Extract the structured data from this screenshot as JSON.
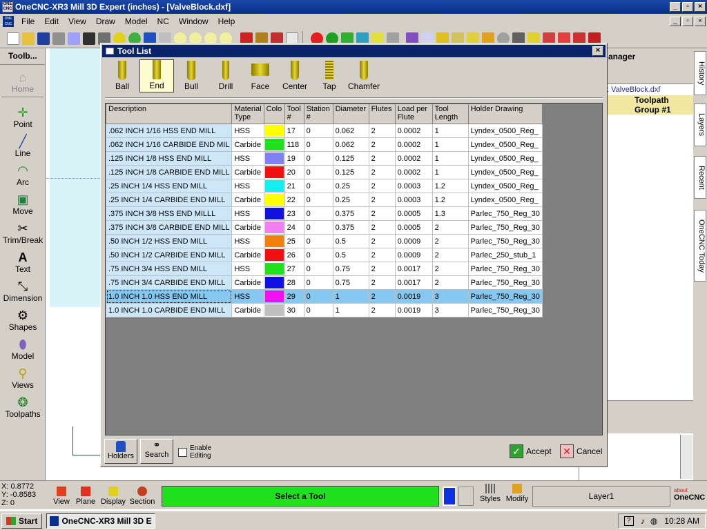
{
  "app": {
    "title": "OneCNC-XR3 Mill 3D Expert (inches) - [ValveBlock.dxf]",
    "window_controls": [
      "_",
      "▫",
      "×"
    ]
  },
  "menu": [
    "File",
    "Edit",
    "View",
    "Draw",
    "Model",
    "NC",
    "Window",
    "Help"
  ],
  "left_panel": {
    "header": "Toolb...",
    "items": [
      {
        "label": "Home",
        "icon": "home-icon"
      },
      {
        "label": "Point",
        "icon": "point-icon"
      },
      {
        "label": "Line",
        "icon": "line-icon"
      },
      {
        "label": "Arc",
        "icon": "arc-icon"
      },
      {
        "label": "Move",
        "icon": "move-icon"
      },
      {
        "label": "Trim/Break",
        "icon": "scissors-icon"
      },
      {
        "label": "Text",
        "icon": "text-icon"
      },
      {
        "label": "Dimension",
        "icon": "dimension-icon"
      },
      {
        "label": "Shapes",
        "icon": "shapes-icon"
      },
      {
        "label": "Model",
        "icon": "model-icon"
      },
      {
        "label": "Views",
        "icon": "views-icon"
      },
      {
        "label": "Toolpaths",
        "icon": "toolpaths-icon"
      }
    ]
  },
  "right_panel": {
    "header": "anager",
    "file": ": ValveBlock.dxf",
    "group": "Toolpath Group #1"
  },
  "side_tabs": [
    "History",
    "Layers",
    "Recent",
    "OneCNC Today"
  ],
  "dialog": {
    "title": "Tool List",
    "tool_types": [
      "Ball",
      "End",
      "Bull",
      "Drill",
      "Face",
      "Center",
      "Tap",
      "Chamfer"
    ],
    "selected_type": "End",
    "columns": [
      "Description",
      "Material Type",
      "Colo",
      "Tool #",
      "Station #",
      "Diameter",
      "Flutes",
      "Load per Flute",
      "Tool Length",
      "Holder Drawing"
    ],
    "rows": [
      {
        "description": ".062 INCH 1/16 HSS END MILL",
        "material": "HSS",
        "color": "#ffff00",
        "tool": "17",
        "station": "0",
        "diameter": "0.062",
        "flutes": "2",
        "load": "0.0002",
        "length": "1",
        "holder": "Lyndex_0500_Reg_"
      },
      {
        "description": ".062 INCH 1/16 CARBIDE END MIL",
        "material": "Carbide",
        "color": "#20e020",
        "tool": "118",
        "station": "0",
        "diameter": "0.062",
        "flutes": "2",
        "load": "0.0002",
        "length": "1",
        "holder": "Lyndex_0500_Reg_"
      },
      {
        "description": ".125 INCH 1/8 HSS END MILL",
        "material": "HSS",
        "color": "#8080f0",
        "tool": "19",
        "station": "0",
        "diameter": "0.125",
        "flutes": "2",
        "load": "0.0002",
        "length": "1",
        "holder": "Lyndex_0500_Reg_"
      },
      {
        "description": ".125 INCH 1/8 CARBIDE END MILL",
        "material": "Carbide",
        "color": "#f01010",
        "tool": "20",
        "station": "0",
        "diameter": "0.125",
        "flutes": "2",
        "load": "0.0002",
        "length": "1",
        "holder": "Lyndex_0500_Reg_"
      },
      {
        "description": ".25 INCH 1/4 HSS END MILL",
        "material": "HSS",
        "color": "#10f0f0",
        "tool": "21",
        "station": "0",
        "diameter": "0.25",
        "flutes": "2",
        "load": "0.0003",
        "length": "1.2",
        "holder": "Lyndex_0500_Reg_"
      },
      {
        "description": ".25 INCH 1/4 CARBIDE END MILL",
        "material": "Carbide",
        "color": "#ffff00",
        "tool": "22",
        "station": "0",
        "diameter": "0.25",
        "flutes": "2",
        "load": "0.0003",
        "length": "1.2",
        "holder": "Lyndex_0500_Reg_"
      },
      {
        "description": ".375 INCH 3/8 HSS END MILLL",
        "material": "HSS",
        "color": "#1010e0",
        "tool": "23",
        "station": "0",
        "diameter": "0.375",
        "flutes": "2",
        "load": "0.0005",
        "length": "1.3",
        "holder": "Parlec_750_Reg_30"
      },
      {
        "description": ".375 INCH 3/8 CARBIDE END MILL",
        "material": "Carbide",
        "color": "#f080f0",
        "tool": "24",
        "station": "0",
        "diameter": "0.375",
        "flutes": "2",
        "load": "0.0005",
        "length": "2",
        "holder": "Parlec_750_Reg_30"
      },
      {
        "description": ".50 INCH 1/2 HSS END MILL",
        "material": "HSS",
        "color": "#f08010",
        "tool": "25",
        "station": "0",
        "diameter": "0.5",
        "flutes": "2",
        "load": "0.0009",
        "length": "2",
        "holder": "Parlec_750_Reg_30"
      },
      {
        "description": ".50 INCH 1/2 CARBIDE END MILL",
        "material": "Carbide",
        "color": "#f01010",
        "tool": "26",
        "station": "0",
        "diameter": "0.5",
        "flutes": "2",
        "load": "0.0009",
        "length": "2",
        "holder": "Parlec_250_stub_1"
      },
      {
        "description": ".75 INCH 3/4 HSS END MILL",
        "material": "HSS",
        "color": "#20e020",
        "tool": "27",
        "station": "0",
        "diameter": "0.75",
        "flutes": "2",
        "load": "0.0017",
        "length": "2",
        "holder": "Parlec_750_Reg_30"
      },
      {
        "description": ".75 INCH 3/4 CARBIDE END MILL",
        "material": "Carbide",
        "color": "#1010e0",
        "tool": "28",
        "station": "0",
        "diameter": "0.75",
        "flutes": "2",
        "load": "0.0017",
        "length": "2",
        "holder": "Parlec_750_Reg_30"
      },
      {
        "description": "1.0 INCH 1.0 HSS END MILL",
        "material": "HSS",
        "color": "#f010f0",
        "tool": "29",
        "station": "0",
        "diameter": "1",
        "flutes": "2",
        "load": "0.0019",
        "length": "3",
        "holder": "Parlec_750_Reg_30"
      },
      {
        "description": "1.0 INCH 1.0 CARBIDE END MILL",
        "material": "Carbide",
        "color": "#c0c0c0",
        "tool": "30",
        "station": "0",
        "diameter": "1",
        "flutes": "2",
        "load": "0.0019",
        "length": "3",
        "holder": "Parlec_750_Reg_30"
      }
    ],
    "selected_row": 12,
    "bottom": {
      "holders": "Holders",
      "search": "Search",
      "enable_editing": "Enable Editing",
      "accept": "Accept",
      "cancel": "Cancel"
    }
  },
  "status": {
    "coords": [
      "X: 0.8772",
      "Y: -0.8583",
      "Z: 0"
    ],
    "buttons": [
      "View",
      "Plane",
      "Display",
      "Section"
    ],
    "prompt": "Select a Tool",
    "right_buttons": [
      "Styles",
      "Modify"
    ],
    "layer": "Layer1",
    "brand_small": "about",
    "brand": "OneCNC"
  },
  "taskbar": {
    "start": "Start",
    "task": "OneCNC-XR3 Mill 3D E...",
    "clock": "10:28 AM"
  }
}
